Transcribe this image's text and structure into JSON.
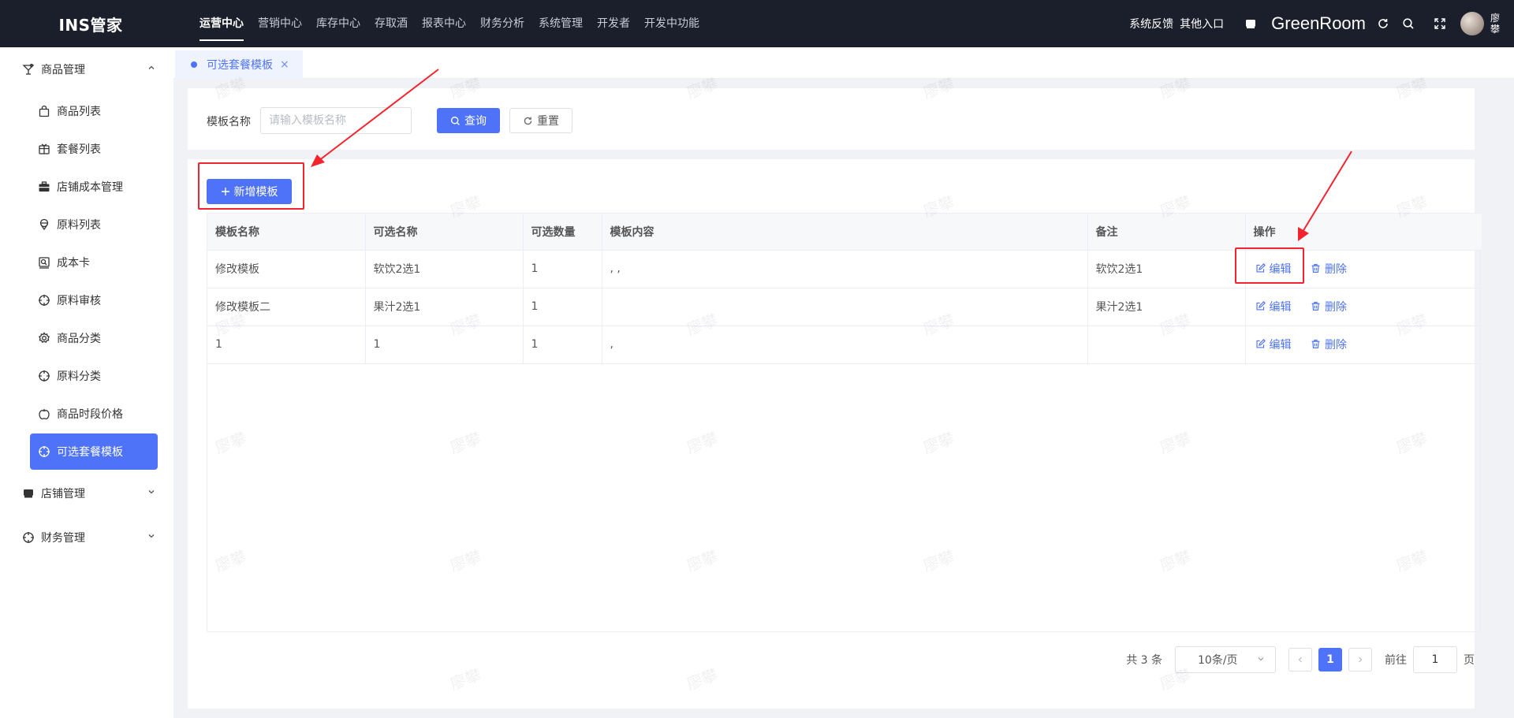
{
  "app": {
    "logo": "INS管家"
  },
  "topnav": [
    {
      "label": "运营中心",
      "active": true
    },
    {
      "label": "营销中心"
    },
    {
      "label": "库存中心"
    },
    {
      "label": "存取酒"
    },
    {
      "label": "报表中心"
    },
    {
      "label": "财务分析"
    },
    {
      "label": "系统管理"
    },
    {
      "label": "开发者"
    },
    {
      "label": "开发中功能"
    }
  ],
  "top_right": {
    "feedback": "系统反馈",
    "other_entry": "其他入口",
    "store_name": "GreenRoom",
    "user_name": "廖攀",
    "icons": [
      "store-icon",
      "refresh-icon",
      "search-icon",
      "fullscreen-icon"
    ]
  },
  "sidebar": {
    "groups": [
      {
        "label": "商品管理",
        "icon": "cocktail-icon",
        "expanded": true,
        "items": [
          {
            "label": "商品列表",
            "icon": "bag-icon"
          },
          {
            "label": "套餐列表",
            "icon": "gift-box-icon"
          },
          {
            "label": "店铺成本管理",
            "icon": "briefcase-icon"
          },
          {
            "label": "原料列表",
            "icon": "ice-cream-icon"
          },
          {
            "label": "成本卡",
            "icon": "card-icon"
          },
          {
            "label": "原料审核",
            "icon": "target-icon"
          },
          {
            "label": "商品分类",
            "icon": "gear-icon"
          },
          {
            "label": "原料分类",
            "icon": "target-icon"
          },
          {
            "label": "商品时段价格",
            "icon": "apple-icon"
          },
          {
            "label": "可选套餐模板",
            "icon": "target-icon",
            "active": true
          }
        ]
      },
      {
        "label": "店铺管理",
        "icon": "shop-icon",
        "expanded": false
      },
      {
        "label": "财务管理",
        "icon": "target-icon",
        "expanded": false
      }
    ]
  },
  "tab": {
    "label": "可选套餐模板",
    "close": "×"
  },
  "search": {
    "label": "模板名称",
    "placeholder": "请输入模板名称",
    "value": "",
    "query_label": "查询",
    "reset_label": "重置"
  },
  "toolbar": {
    "add_label": "新增模板"
  },
  "table": {
    "columns": [
      "模板名称",
      "可选名称",
      "可选数量",
      "模板内容",
      "备注",
      "操作"
    ],
    "rows": [
      {
        "template_name": "修改模板",
        "option_name": "软饮2选1",
        "count": "1",
        "content": ", ,",
        "remark": "软饮2选1"
      },
      {
        "template_name": "修改模板二",
        "option_name": "果汁2选1",
        "count": "1",
        "content": "",
        "remark": "果汁2选1"
      },
      {
        "template_name": "1",
        "option_name": "1",
        "count": "1",
        "content": ",",
        "remark": ""
      }
    ],
    "edit_label": "编辑",
    "delete_label": "删除"
  },
  "pagination": {
    "total_text": "共 3 条",
    "page_size": "10条/页",
    "current_page": "1",
    "goto_label": "前往",
    "goto_value": "1",
    "page_unit": "页"
  },
  "watermark": "廖攀",
  "colors": {
    "primary": "#4e73f8",
    "header_bg": "#1b1e2b",
    "annotation": "#f3242e"
  }
}
